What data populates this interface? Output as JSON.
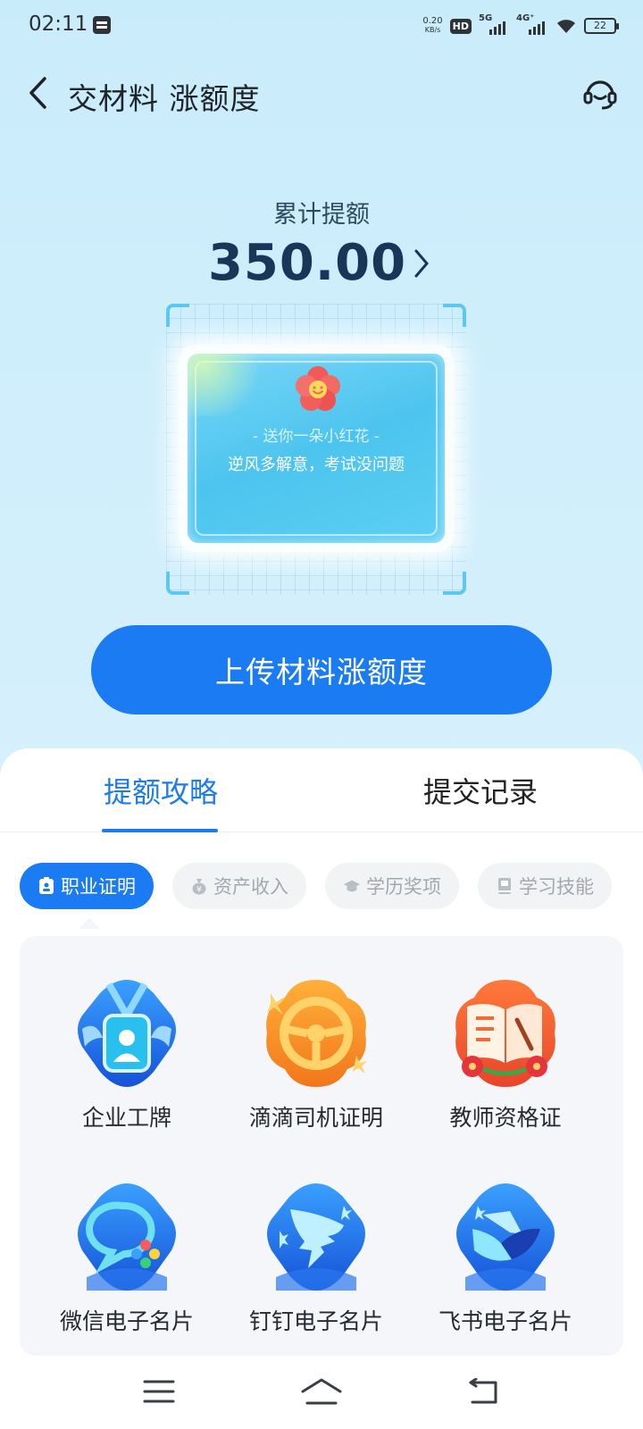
{
  "status_bar": {
    "time": "02:11",
    "net_speed_value": "0.20",
    "net_speed_unit": "KB/s",
    "hd_label": "HD",
    "sim1_label": "5G",
    "sim2_label": "4G⁺",
    "battery": "22"
  },
  "header": {
    "title": "交材料 涨额度",
    "back_icon": "chevron-left-icon",
    "service_icon": "headset-icon"
  },
  "quota": {
    "label": "累计提额",
    "value": "350.00"
  },
  "card": {
    "subtitle": "- 送你一朵小红花 -",
    "message": "逆风多解意，考试没问题"
  },
  "upload_button": "上传材料涨额度",
  "tabs": [
    {
      "label": "提额攻略",
      "active": true
    },
    {
      "label": "提交记录",
      "active": false
    }
  ],
  "categories": [
    {
      "label": "职业证明",
      "icon": "badge-icon",
      "active": true
    },
    {
      "label": "资产收入",
      "icon": "money-bag-icon",
      "active": false
    },
    {
      "label": "学历奖项",
      "icon": "graduation-cap-icon",
      "active": false
    },
    {
      "label": "学习技能",
      "icon": "book-icon",
      "active": false
    }
  ],
  "documents": [
    {
      "label": "企业工牌",
      "icon": "employee-badge-icon"
    },
    {
      "label": "滴滴司机证明",
      "icon": "steering-wheel-icon"
    },
    {
      "label": "教师资格证",
      "icon": "open-book-icon"
    },
    {
      "label": "微信电子名片",
      "icon": "wechat-card-icon"
    },
    {
      "label": "钉钉电子名片",
      "icon": "dingtalk-card-icon"
    },
    {
      "label": "飞书电子名片",
      "icon": "feishu-card-icon"
    }
  ],
  "colors": {
    "primary": "#1a7bf2",
    "quota_text": "#1b3558",
    "background": "#cfeefb"
  }
}
